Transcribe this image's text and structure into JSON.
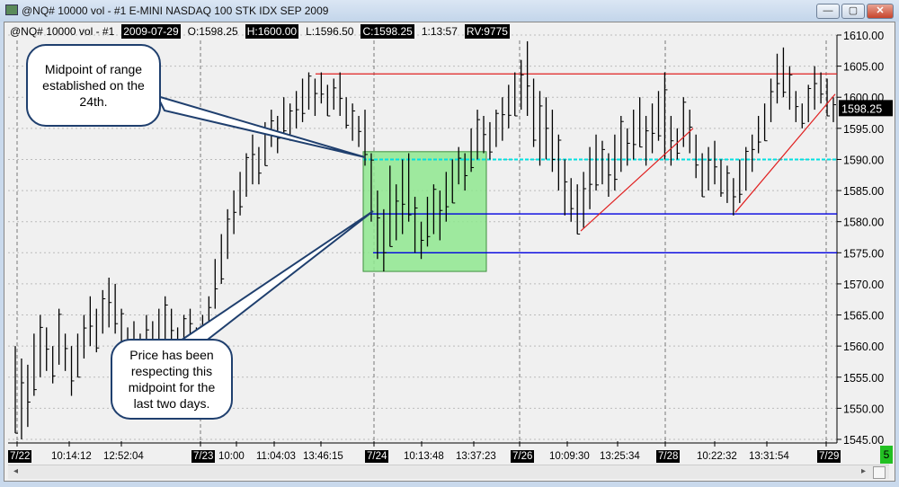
{
  "window": {
    "title": "@NQ# 10000 vol - #1 E-MINI NASDAQ 100 STK IDX SEP 2009",
    "buttons": [
      "minimize",
      "maximize",
      "close"
    ]
  },
  "info": {
    "symbol": "@NQ#  10000 vol - #1",
    "date": "2009-07-29",
    "open": "O:1598.25",
    "high": "H:1600.00",
    "low": "L:1596.50",
    "close": "C:1598.25",
    "time": "1:13:57",
    "rv": "RV:9775"
  },
  "chart_data": {
    "type": "ohlc-bar",
    "ylim": [
      1545,
      1610
    ],
    "yticks": [
      "1610.00",
      "1605.00",
      "1600.00",
      "1595.00",
      "1590.00",
      "1585.00",
      "1580.00",
      "1575.00",
      "1570.00",
      "1565.00",
      "1560.00",
      "1555.00",
      "1550.00",
      "1545.00"
    ],
    "last_price": "1598.25",
    "xticks": [
      {
        "label": "7/22",
        "date": true
      },
      {
        "label": "10:14:12"
      },
      {
        "label": "12:52:04"
      },
      {
        "label": "7/23",
        "date": true
      },
      {
        "label": "10:00"
      },
      {
        "label": "11:04:03"
      },
      {
        "label": "13:46:15"
      },
      {
        "label": "7/24",
        "date": true
      },
      {
        "label": "10:13:48"
      },
      {
        "label": "13:37:23"
      },
      {
        "label": "7/26",
        "date": true
      },
      {
        "label": "10:09:30"
      },
      {
        "label": "13:25:34"
      },
      {
        "label": "7/28",
        "date": true
      },
      {
        "label": "10:22:32"
      },
      {
        "label": "13:31:54"
      },
      {
        "label": "7/29",
        "date": true
      }
    ],
    "bars_high_low": [
      [
        1560,
        1546
      ],
      [
        1558,
        1545
      ],
      [
        1557,
        1547
      ],
      [
        1562,
        1552
      ],
      [
        1565,
        1555
      ],
      [
        1563,
        1556
      ],
      [
        1560,
        1554
      ],
      [
        1566,
        1557
      ],
      [
        1562,
        1556
      ],
      [
        1560,
        1552
      ],
      [
        1562,
        1555
      ],
      [
        1565,
        1558
      ],
      [
        1568,
        1560
      ],
      [
        1566,
        1559
      ],
      [
        1569,
        1562
      ],
      [
        1571,
        1563
      ],
      [
        1570,
        1562
      ],
      [
        1566,
        1558
      ],
      [
        1563,
        1556
      ],
      [
        1564,
        1557
      ],
      [
        1562,
        1555
      ],
      [
        1565,
        1557
      ],
      [
        1564,
        1558
      ],
      [
        1566,
        1560
      ],
      [
        1568,
        1561
      ],
      [
        1566,
        1559
      ],
      [
        1563,
        1558
      ],
      [
        1565,
        1559
      ],
      [
        1566,
        1560
      ],
      [
        1563,
        1558
      ],
      [
        1565,
        1559
      ],
      [
        1568,
        1562
      ],
      [
        1574,
        1566
      ],
      [
        1578,
        1570
      ],
      [
        1582,
        1574
      ],
      [
        1585,
        1578
      ],
      [
        1588,
        1581
      ],
      [
        1591,
        1584
      ],
      [
        1594,
        1586
      ],
      [
        1592,
        1586
      ],
      [
        1596,
        1589
      ],
      [
        1598,
        1592
      ],
      [
        1597,
        1591
      ],
      [
        1600,
        1594
      ],
      [
        1599,
        1593
      ],
      [
        1601,
        1595
      ],
      [
        1603,
        1596
      ],
      [
        1604,
        1598
      ],
      [
        1603,
        1597
      ],
      [
        1604,
        1599
      ],
      [
        1602,
        1597
      ],
      [
        1603,
        1598
      ],
      [
        1604,
        1597
      ],
      [
        1600,
        1595
      ],
      [
        1599,
        1593
      ],
      [
        1597,
        1592
      ],
      [
        1598,
        1589
      ],
      [
        1591,
        1580
      ],
      [
        1585,
        1574
      ],
      [
        1582,
        1572
      ],
      [
        1589,
        1576
      ],
      [
        1586,
        1577
      ],
      [
        1590,
        1578
      ],
      [
        1591,
        1580
      ],
      [
        1584,
        1575
      ],
      [
        1580,
        1574
      ],
      [
        1584,
        1576
      ],
      [
        1586,
        1578
      ],
      [
        1585,
        1577
      ],
      [
        1588,
        1580
      ],
      [
        1590,
        1583
      ],
      [
        1592,
        1586
      ],
      [
        1591,
        1585
      ],
      [
        1595,
        1588
      ],
      [
        1598,
        1590
      ],
      [
        1597,
        1591
      ],
      [
        1596,
        1590
      ],
      [
        1598,
        1592
      ],
      [
        1600,
        1593
      ],
      [
        1602,
        1595
      ],
      [
        1604,
        1597
      ],
      [
        1606,
        1598
      ],
      [
        1609,
        1597
      ],
      [
        1603,
        1592
      ],
      [
        1601,
        1589
      ],
      [
        1600,
        1590
      ],
      [
        1598,
        1588
      ],
      [
        1594,
        1585
      ],
      [
        1590,
        1581
      ],
      [
        1587,
        1580
      ],
      [
        1586,
        1578
      ],
      [
        1588,
        1579
      ],
      [
        1592,
        1582
      ],
      [
        1594,
        1585
      ],
      [
        1593,
        1586
      ],
      [
        1591,
        1584
      ],
      [
        1594,
        1585
      ],
      [
        1597,
        1588
      ],
      [
        1595,
        1589
      ],
      [
        1598,
        1590
      ],
      [
        1600,
        1592
      ],
      [
        1597,
        1589
      ],
      [
        1599,
        1591
      ],
      [
        1601,
        1593
      ],
      [
        1604,
        1590
      ],
      [
        1597,
        1589
      ],
      [
        1595,
        1590
      ],
      [
        1600,
        1592
      ],
      [
        1598,
        1591
      ],
      [
        1594,
        1587
      ],
      [
        1591,
        1584
      ],
      [
        1592,
        1585
      ],
      [
        1593,
        1586
      ],
      [
        1590,
        1584
      ],
      [
        1589,
        1583
      ],
      [
        1587,
        1581
      ],
      [
        1590,
        1583
      ],
      [
        1592,
        1585
      ],
      [
        1594,
        1588
      ],
      [
        1597,
        1591
      ],
      [
        1599,
        1593
      ],
      [
        1603,
        1596
      ],
      [
        1607,
        1599
      ],
      [
        1608,
        1600
      ],
      [
        1605,
        1598
      ],
      [
        1601,
        1596
      ],
      [
        1599,
        1595
      ],
      [
        1602,
        1596
      ],
      [
        1605,
        1598
      ],
      [
        1604,
        1599
      ],
      [
        1603,
        1597
      ],
      [
        1600,
        1596
      ]
    ],
    "levels": {
      "range_high": 1603.75,
      "midpoint_dashed": 1590,
      "midpoint": 1581.25,
      "range_low": 1575
    },
    "range_box": {
      "top": 1591.25,
      "bottom": 1572
    },
    "trendlines": [
      [
        1578.5,
        1595
      ],
      [
        1581.5,
        1600.5
      ]
    ],
    "colors": {
      "resistance": "#e02020",
      "midpoint_dashed": "#00e0e0",
      "support": "#0000e0",
      "box": "#90e890",
      "trend": "#e02020"
    },
    "annotations": [
      "Midpoint of range established on the 24th.",
      "Price has been respecting this midpoint for the last two days."
    ]
  },
  "status": {
    "count": "5"
  }
}
